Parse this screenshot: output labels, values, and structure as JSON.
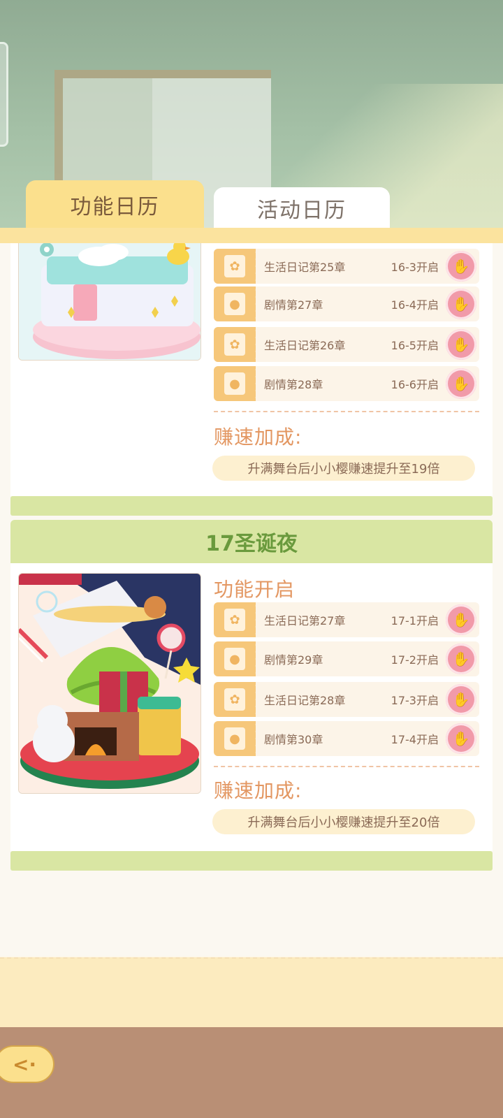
{
  "tabs": {
    "function_calendar": "功能日历",
    "event_calendar": "活动日历"
  },
  "day16": {
    "items": [
      {
        "name": "生活日记第25章",
        "stage": "16-3开启",
        "icon": "bunny-diary-icon"
      },
      {
        "name": "剧情第27章",
        "stage": "16-4开启",
        "icon": "camera-icon"
      },
      {
        "name": "生活日记第26章",
        "stage": "16-5开启",
        "icon": "bunny-diary-icon"
      },
      {
        "name": "剧情第28章",
        "stage": "16-6开启",
        "icon": "camera-icon"
      }
    ],
    "speed_title": "赚速加成:",
    "speed_text": "升满舞台后小小樱赚速提升至19倍"
  },
  "day17": {
    "title": "17圣诞夜",
    "unlock_title": "功能开启",
    "items": [
      {
        "name": "生活日记第27章",
        "stage": "17-1开启",
        "icon": "bunny-diary-icon"
      },
      {
        "name": "剧情第29章",
        "stage": "17-2开启",
        "icon": "camera-icon"
      },
      {
        "name": "生活日记第28章",
        "stage": "17-3开启",
        "icon": "bunny-diary-icon"
      },
      {
        "name": "剧情第30章",
        "stage": "17-4开启",
        "icon": "camera-icon"
      }
    ],
    "speed_title": "赚速加成:",
    "speed_text": "升满舞台后小小樱赚速提升至20倍"
  },
  "colors": {
    "accent": "#e39762",
    "tab_active": "#fbe08d",
    "day_header": "#d9e6a3",
    "go_button": "#f19aa9"
  }
}
